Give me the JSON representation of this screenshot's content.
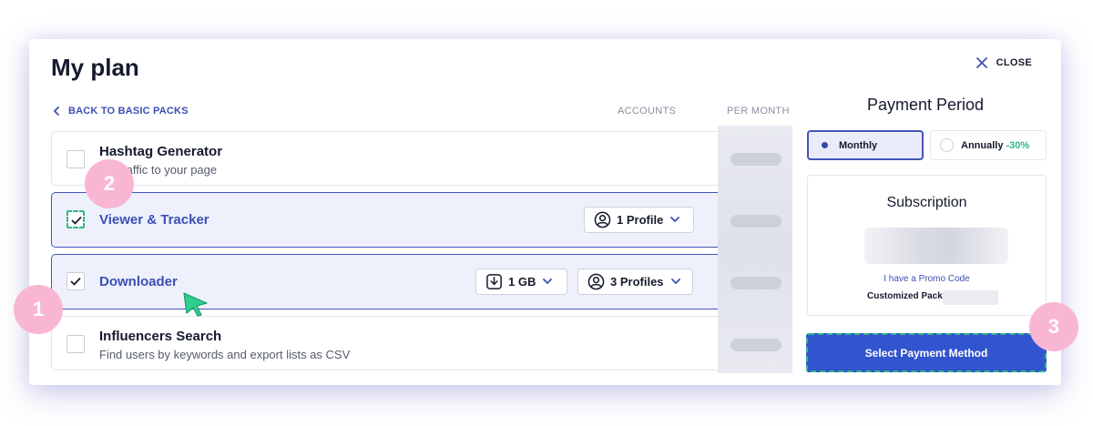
{
  "header": {
    "title": "My plan",
    "close_label": "CLOSE"
  },
  "nav": {
    "back_label": "BACK TO BASIC PACKS"
  },
  "columns": {
    "accounts": "ACCOUNTS",
    "per_month": "PER MONTH"
  },
  "features": [
    {
      "name": "Hashtag Generator",
      "description": "the traffic to your page",
      "checked": false
    },
    {
      "name": "Viewer & Tracker",
      "checked": true,
      "profile_option": "1 Profile"
    },
    {
      "name": "Downloader",
      "checked": true,
      "storage_option": "1 GB",
      "profile_option": "3 Profiles"
    },
    {
      "name": "Influencers Search",
      "description": "Find users by keywords and export lists as CSV",
      "checked": false
    }
  ],
  "payment": {
    "title": "Payment Period",
    "monthly_label": "Monthly",
    "annually_label": "Annually",
    "annual_discount": "-30%",
    "selected": "monthly"
  },
  "subscription": {
    "title": "Subscription",
    "promo_link": "I have a Promo Code",
    "pack_label": "Customized Pack"
  },
  "cta": {
    "label": "Select Payment Method"
  },
  "annotations": {
    "step1": "1",
    "step2": "2",
    "step3": "3"
  },
  "colors": {
    "accent": "#3d4fb4",
    "button": "#3254ce",
    "highlight": "#2fb788",
    "badge": "#f9b6d2"
  },
  "icons": [
    "close-icon",
    "chevron-left-icon",
    "check-icon",
    "user-circle-icon",
    "download-box-icon",
    "chevron-down-icon",
    "cursor-arrow-icon"
  ]
}
